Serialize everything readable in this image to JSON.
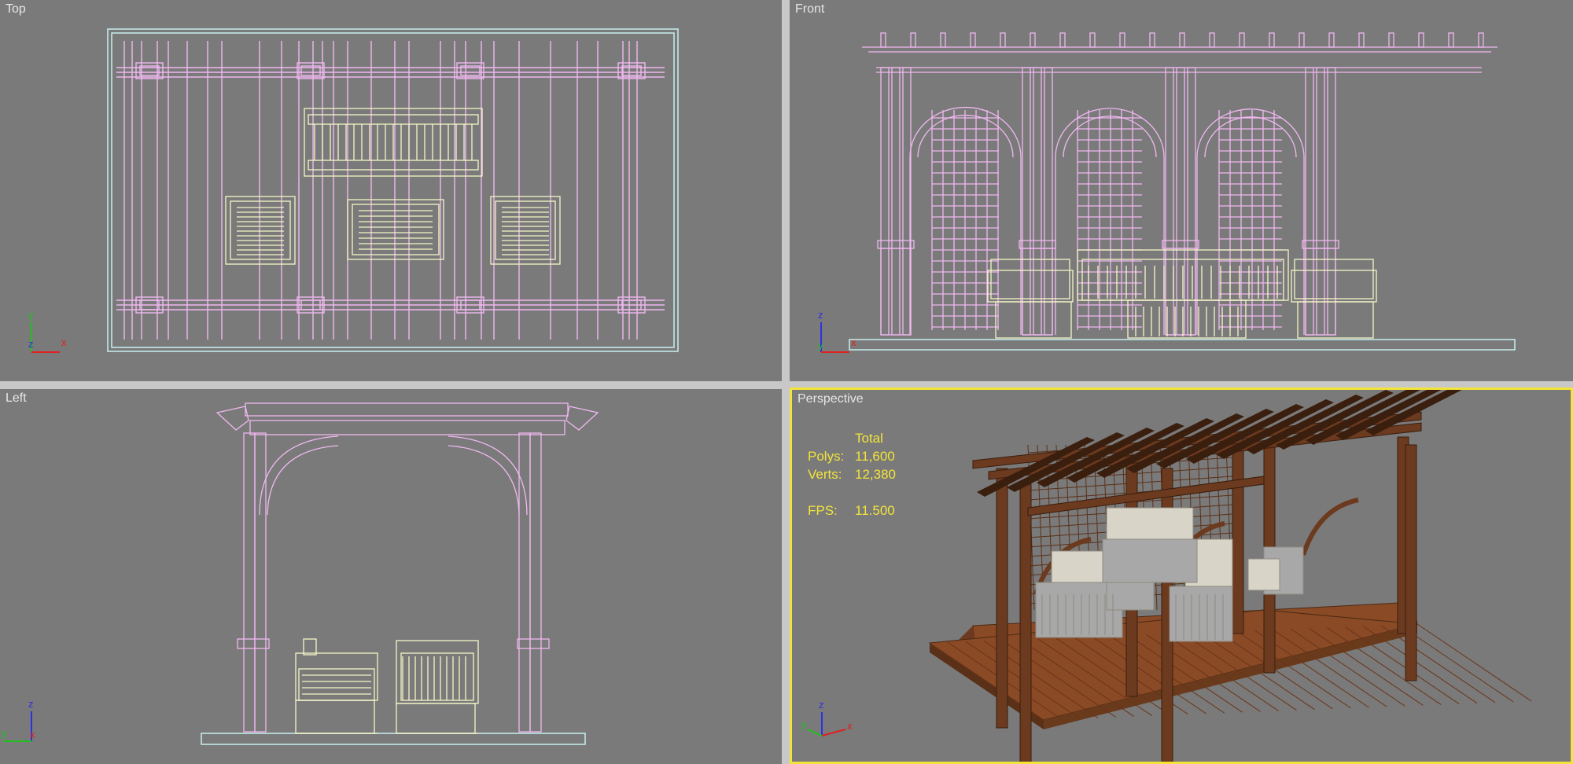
{
  "viewports": {
    "top": {
      "label": "Top"
    },
    "front": {
      "label": "Front"
    },
    "left": {
      "label": "Left"
    },
    "perspective": {
      "label": "Perspective"
    }
  },
  "stats": {
    "header": "Total",
    "polys_label": "Polys:",
    "polys_value": "11,600",
    "verts_label": "Verts:",
    "verts_value": "12,380",
    "fps_label": "FPS:",
    "fps_value": "11.500"
  },
  "axes": {
    "top": {
      "a": "y",
      "b": "x",
      "c": "z"
    },
    "front": {
      "a": "z",
      "b": "x",
      "c": "y"
    },
    "left": {
      "a": "z",
      "b": "y",
      "c": "x"
    },
    "perspective": {
      "a": "z",
      "b": "x",
      "c": "y"
    }
  },
  "colors": {
    "viewport_bg": "#7a7a7a",
    "structure_wire": "#f0b8f0",
    "furniture_wire": "#f5f5c8",
    "ground_wire": "#c8f0f0",
    "active_border": "#f2e43a",
    "wood": "#6b3a1f",
    "deck": "#8a4a26",
    "cushion": "#d8d4c8"
  }
}
